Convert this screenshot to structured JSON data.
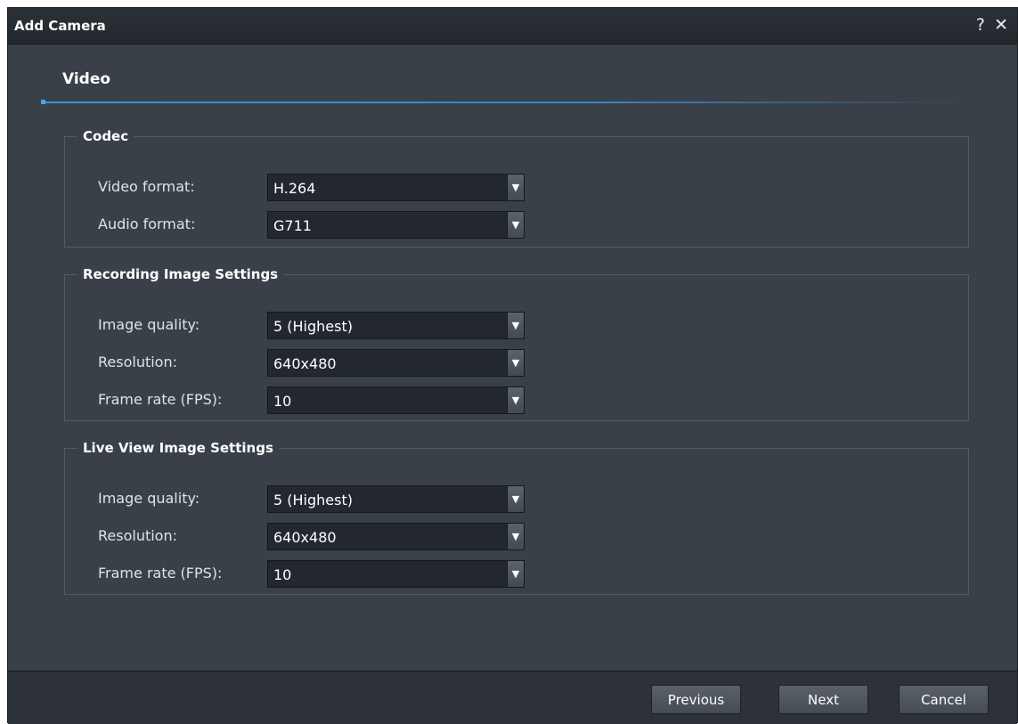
{
  "window": {
    "title": "Add Camera",
    "help_glyph": "?",
    "close_glyph": "✕"
  },
  "section": {
    "title": "Video"
  },
  "codec": {
    "legend": "Codec",
    "video_format_label": "Video format:",
    "video_format_value": "H.264",
    "audio_format_label": "Audio format:",
    "audio_format_value": "G711"
  },
  "recording": {
    "legend": "Recording Image Settings",
    "image_quality_label": "Image quality:",
    "image_quality_value": "5 (Highest)",
    "resolution_label": "Resolution:",
    "resolution_value": "640x480",
    "frame_rate_label": "Frame rate (FPS):",
    "frame_rate_value": "10"
  },
  "live_view": {
    "legend": "Live View Image Settings",
    "image_quality_label": "Image quality:",
    "image_quality_value": "5 (Highest)",
    "resolution_label": "Resolution:",
    "resolution_value": "640x480",
    "frame_rate_label": "Frame rate (FPS):",
    "frame_rate_value": "10"
  },
  "footer": {
    "previous_label": "Previous",
    "next_label": "Next",
    "cancel_label": "Cancel"
  },
  "icons": {
    "dropdown_arrow": "chevron-down-icon",
    "help": "question-icon",
    "close": "close-icon"
  },
  "colors": {
    "accent": "#3f8fd6",
    "background": "#3a4047",
    "input_background": "#232830"
  }
}
